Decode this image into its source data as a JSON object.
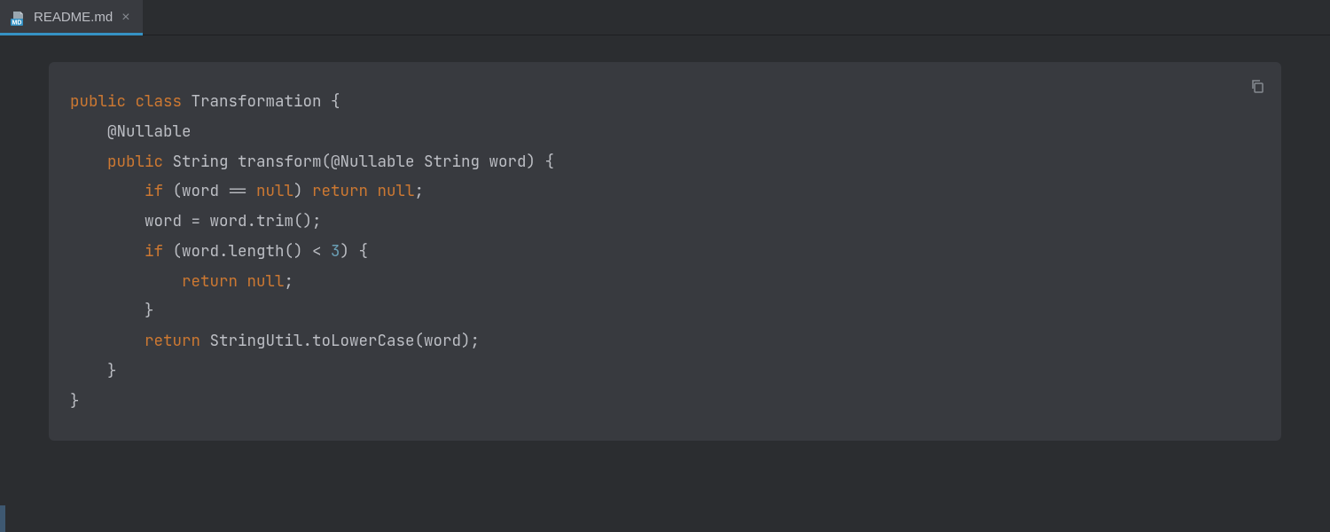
{
  "tab": {
    "filename": "README.md",
    "icon_label": "MD"
  },
  "code": {
    "line1_kw1": "public",
    "line1_kw2": "class",
    "line1_name": "Transformation {",
    "line2": "",
    "line3_annotation": "    @Nullable",
    "line4_kw": "public",
    "line4_rest": " String transform(@Nullable String word) {",
    "line5_kw1": "if",
    "line5_mid": " (word == ",
    "line5_null1": "null",
    "line5_paren": ") ",
    "line5_kw2": "return",
    "line5_sp": " ",
    "line5_null2": "null",
    "line5_semi": ";",
    "line6": "        word = word.trim();",
    "line7_kw": "if",
    "line7_mid": " (word.length() < ",
    "line7_num": "3",
    "line7_end": ") {",
    "line8_kw": "return",
    "line8_sp": " ",
    "line8_null": "null",
    "line8_semi": ";",
    "line9": "        }",
    "line10": "",
    "line11_kw": "return",
    "line11_rest": " StringUtil.toLowerCase(word);",
    "line12": "    }",
    "line13": "}"
  }
}
